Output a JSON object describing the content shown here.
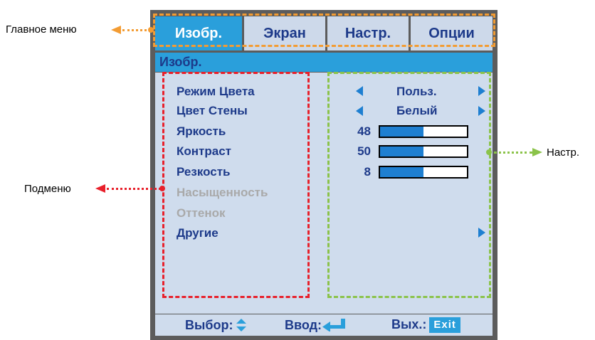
{
  "tabs": [
    "Изобр.",
    "Экран",
    "Настр.",
    "Опции"
  ],
  "section_title": "Изобр.",
  "submenu": [
    {
      "label": "Режим Цвета",
      "enabled": true
    },
    {
      "label": "Цвет Стены",
      "enabled": true
    },
    {
      "label": "Яркость",
      "enabled": true
    },
    {
      "label": "Контраст",
      "enabled": true
    },
    {
      "label": "Резкость",
      "enabled": true
    },
    {
      "label": "Насыщенность",
      "enabled": false
    },
    {
      "label": "Оттенок",
      "enabled": false
    },
    {
      "label": "Другие",
      "enabled": true
    }
  ],
  "settings": {
    "color_mode": "Польз.",
    "wall_color": "Белый",
    "brightness": {
      "value": "48",
      "level": 0.5
    },
    "contrast": {
      "value": "50",
      "level": 0.5
    },
    "sharpness": {
      "value": "8",
      "level": 0.5
    }
  },
  "footer": {
    "select": "Выбор:",
    "enter": "Ввод:",
    "exit": "Вых.:",
    "exit_key": "Exit"
  },
  "annotations": {
    "main_menu": "Главное меню",
    "submenu": "Подменю",
    "settings": "Настр."
  },
  "colors": {
    "main_menu": "#f39c33",
    "submenu": "#e8202b",
    "settings": "#8bc34a",
    "accent": "#2a9fdb",
    "text": "#1d3a8a"
  },
  "icons": {
    "select": "up-down-arrows-icon",
    "enter": "enter-return-icon",
    "left": "triangle-left-icon",
    "right": "triangle-right-icon"
  }
}
